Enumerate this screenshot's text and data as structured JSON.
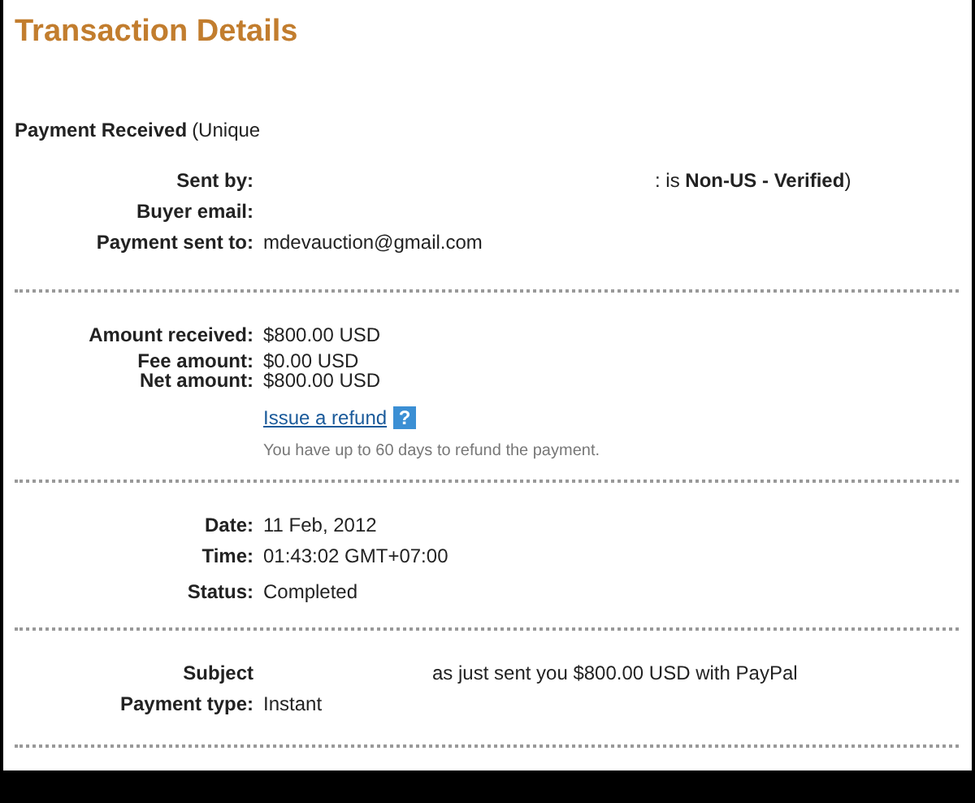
{
  "title": "Transaction Details",
  "heading": {
    "label": "Payment Received",
    "note": "(Unique"
  },
  "sections": [
    {
      "rows": [
        {
          "label": "Sent by:",
          "value": ": is **Non-US - Verified**)",
          "kind": "maskedwide"
        },
        {
          "label": "Buyer email:",
          "kind": "plain"
        },
        {
          "label": "Payment sent to:",
          "value": "mdevauction@gmail.com",
          "kind": "plain"
        }
      ]
    },
    {
      "rows": [
        {
          "label": "Amount received:",
          "value": "$800.00 USD",
          "kind": "plain"
        },
        {
          "label": "Fee amount:",
          "value": "$0.00 USD",
          "kind": "tight"
        },
        {
          "label": "Net amount:",
          "value": "$800.00 USD",
          "kind": "tight"
        }
      ],
      "refund": {
        "link": "Issue a refund",
        "help": "?",
        "note": "You have up to 60 days to refund the payment."
      }
    },
    {
      "rows": [
        {
          "label": "Date:",
          "value": "11 Feb, 2012",
          "kind": "plain"
        },
        {
          "label": "Time:",
          "value": "01:43:02 GMT+07:00",
          "kind": "plain"
        },
        {
          "label": "Status:",
          "value": "Completed",
          "kind": "spaced"
        }
      ]
    },
    {
      "rows": [
        {
          "label": "Subject",
          "value": "as just sent you $800.00 USD with PayPal",
          "kind": "maskednarrow"
        },
        {
          "label": "Payment type:",
          "value": "Instant",
          "kind": "plain"
        }
      ]
    }
  ]
}
